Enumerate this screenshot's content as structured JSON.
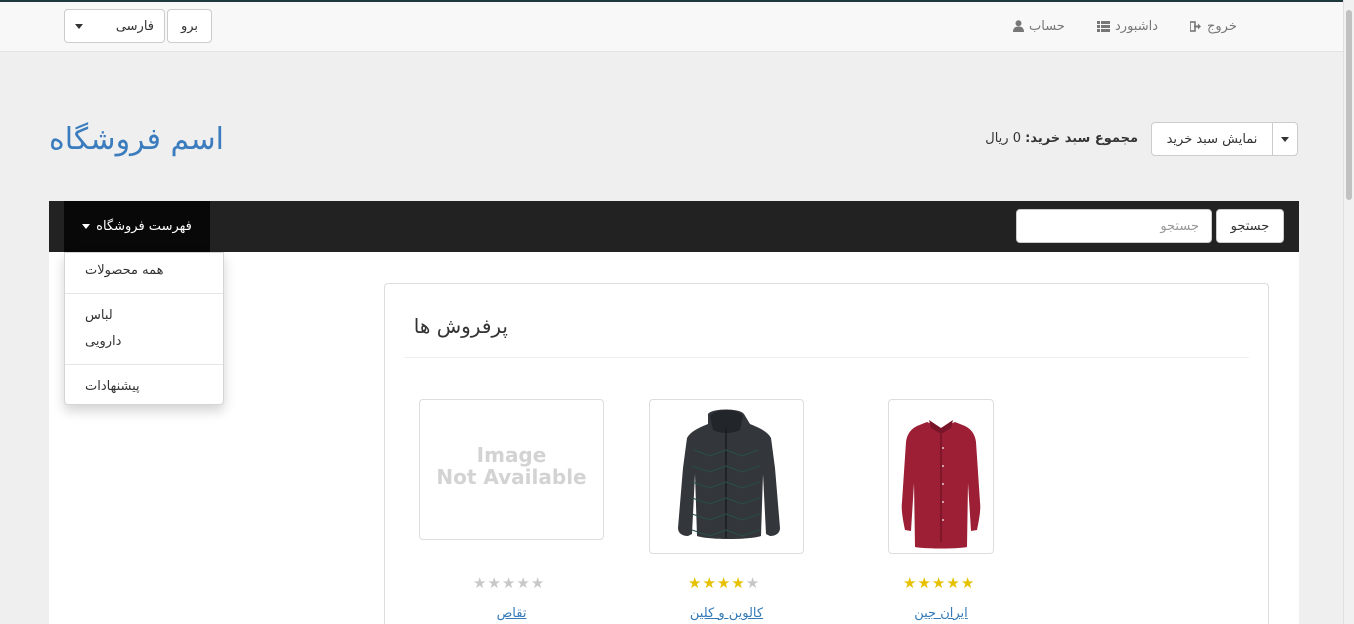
{
  "topbar": {
    "language_value": "فارسی",
    "go_label": "برو",
    "links": [
      {
        "label": "خروج",
        "icon": "sign-out-icon"
      },
      {
        "label": "داشبورد",
        "icon": "list-icon"
      },
      {
        "label": "حساب",
        "icon": "user-icon"
      }
    ]
  },
  "header": {
    "store_name": "اسم فروشگاه",
    "cart_total_label": "مجموع سبد خرید:",
    "cart_total_value": "0 ریال",
    "cart_button_label": "نمایش سبد خرید"
  },
  "navbar": {
    "menu_label": "فهرست فروشگاه",
    "search_placeholder": "جستجو",
    "search_button_label": "جستجو"
  },
  "dropdown": {
    "items": [
      "همه محصولات",
      "لباس",
      "دارویی",
      "پیشنهادات"
    ]
  },
  "bestsellers": {
    "title": "پرفروش ها",
    "image_not_available_line1": "Image",
    "image_not_available_line2": "Not Available",
    "products": [
      {
        "name": "تقاص",
        "rating": 0,
        "image": "image-not-available"
      },
      {
        "name": "کالوین و کلین",
        "rating": 4,
        "image": "jacket-image"
      },
      {
        "name": "ایران جین",
        "rating": 5,
        "image": "shirt-image"
      }
    ]
  },
  "colors": {
    "brand_link": "#3a7cbd",
    "navbar_bg": "#222222",
    "star_on": "#e5c100",
    "star_off": "#c8c8c8"
  }
}
